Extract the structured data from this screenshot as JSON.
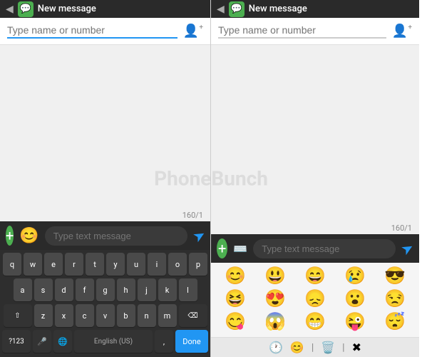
{
  "left_panel": {
    "status_bar": {
      "back_arrow": "◀",
      "title": "New message"
    },
    "to_field": {
      "placeholder": "Type name or number"
    },
    "char_count": "160/1",
    "compose_bar": {
      "text_placeholder": "Type text message"
    },
    "keyboard": {
      "row1": [
        "q",
        "w",
        "e",
        "r",
        "t",
        "y",
        "u",
        "i",
        "o",
        "p"
      ],
      "row2": [
        "a",
        "s",
        "d",
        "f",
        "g",
        "h",
        "j",
        "k",
        "l"
      ],
      "row3": [
        "z",
        "x",
        "c",
        "v",
        "b",
        "n",
        "m"
      ],
      "bottom": [
        "?123",
        "mic",
        "globe",
        "English (US)",
        ",",
        "Done"
      ]
    }
  },
  "right_panel": {
    "status_bar": {
      "back_arrow": "◀",
      "title": "New message"
    },
    "to_field": {
      "placeholder": "Type name or number"
    },
    "char_count": "160/1",
    "compose_bar": {
      "text_placeholder": "Type text message"
    },
    "emojis": {
      "row1": [
        "😊",
        "😃",
        "😄",
        "😢",
        "😎"
      ],
      "row2": [
        "😆",
        "😍",
        "😞",
        "😮",
        "😒"
      ],
      "row3": [
        "😋",
        "😱",
        "😁",
        "😜",
        "😴"
      ]
    }
  },
  "watermark": "PhoneBunch"
}
